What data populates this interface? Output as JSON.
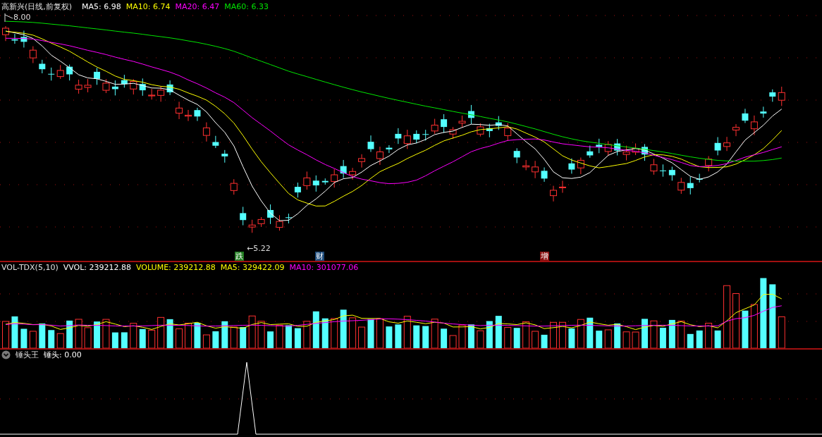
{
  "price_panel": {
    "title": "高新兴(日线,前复权)",
    "indicators": [
      {
        "text": "MA5: 6.98",
        "color": "#ffffff"
      },
      {
        "text": "MA10: 6.74",
        "color": "#ffff00"
      },
      {
        "text": "MA20: 6.47",
        "color": "#ff00ff"
      },
      {
        "text": "MA60: 6.33",
        "color": "#00e600"
      }
    ],
    "high_label": "8.00",
    "low_label": "←5.22",
    "events": [
      {
        "text": "跌",
        "color": "#1e7a1e"
      },
      {
        "text": "财",
        "color": "#1c4a7a"
      },
      {
        "text": "增",
        "color": "#8a1010"
      }
    ]
  },
  "volume_panel": {
    "title": "VOL-TDX(5,10)",
    "indicators": [
      {
        "text": "VVOL: 239212.88",
        "color": "#ffffff"
      },
      {
        "text": "VOLUME: 239212.88",
        "color": "#ffff00"
      },
      {
        "text": "MA5: 329422.09",
        "color": "#ffff00"
      },
      {
        "text": "MA10: 301077.06",
        "color": "#ff00ff"
      }
    ]
  },
  "indicator_panel": {
    "title": "锤头王",
    "indicators": [
      {
        "text": "锤头: 0.00",
        "color": "#ffffff"
      }
    ]
  }
}
